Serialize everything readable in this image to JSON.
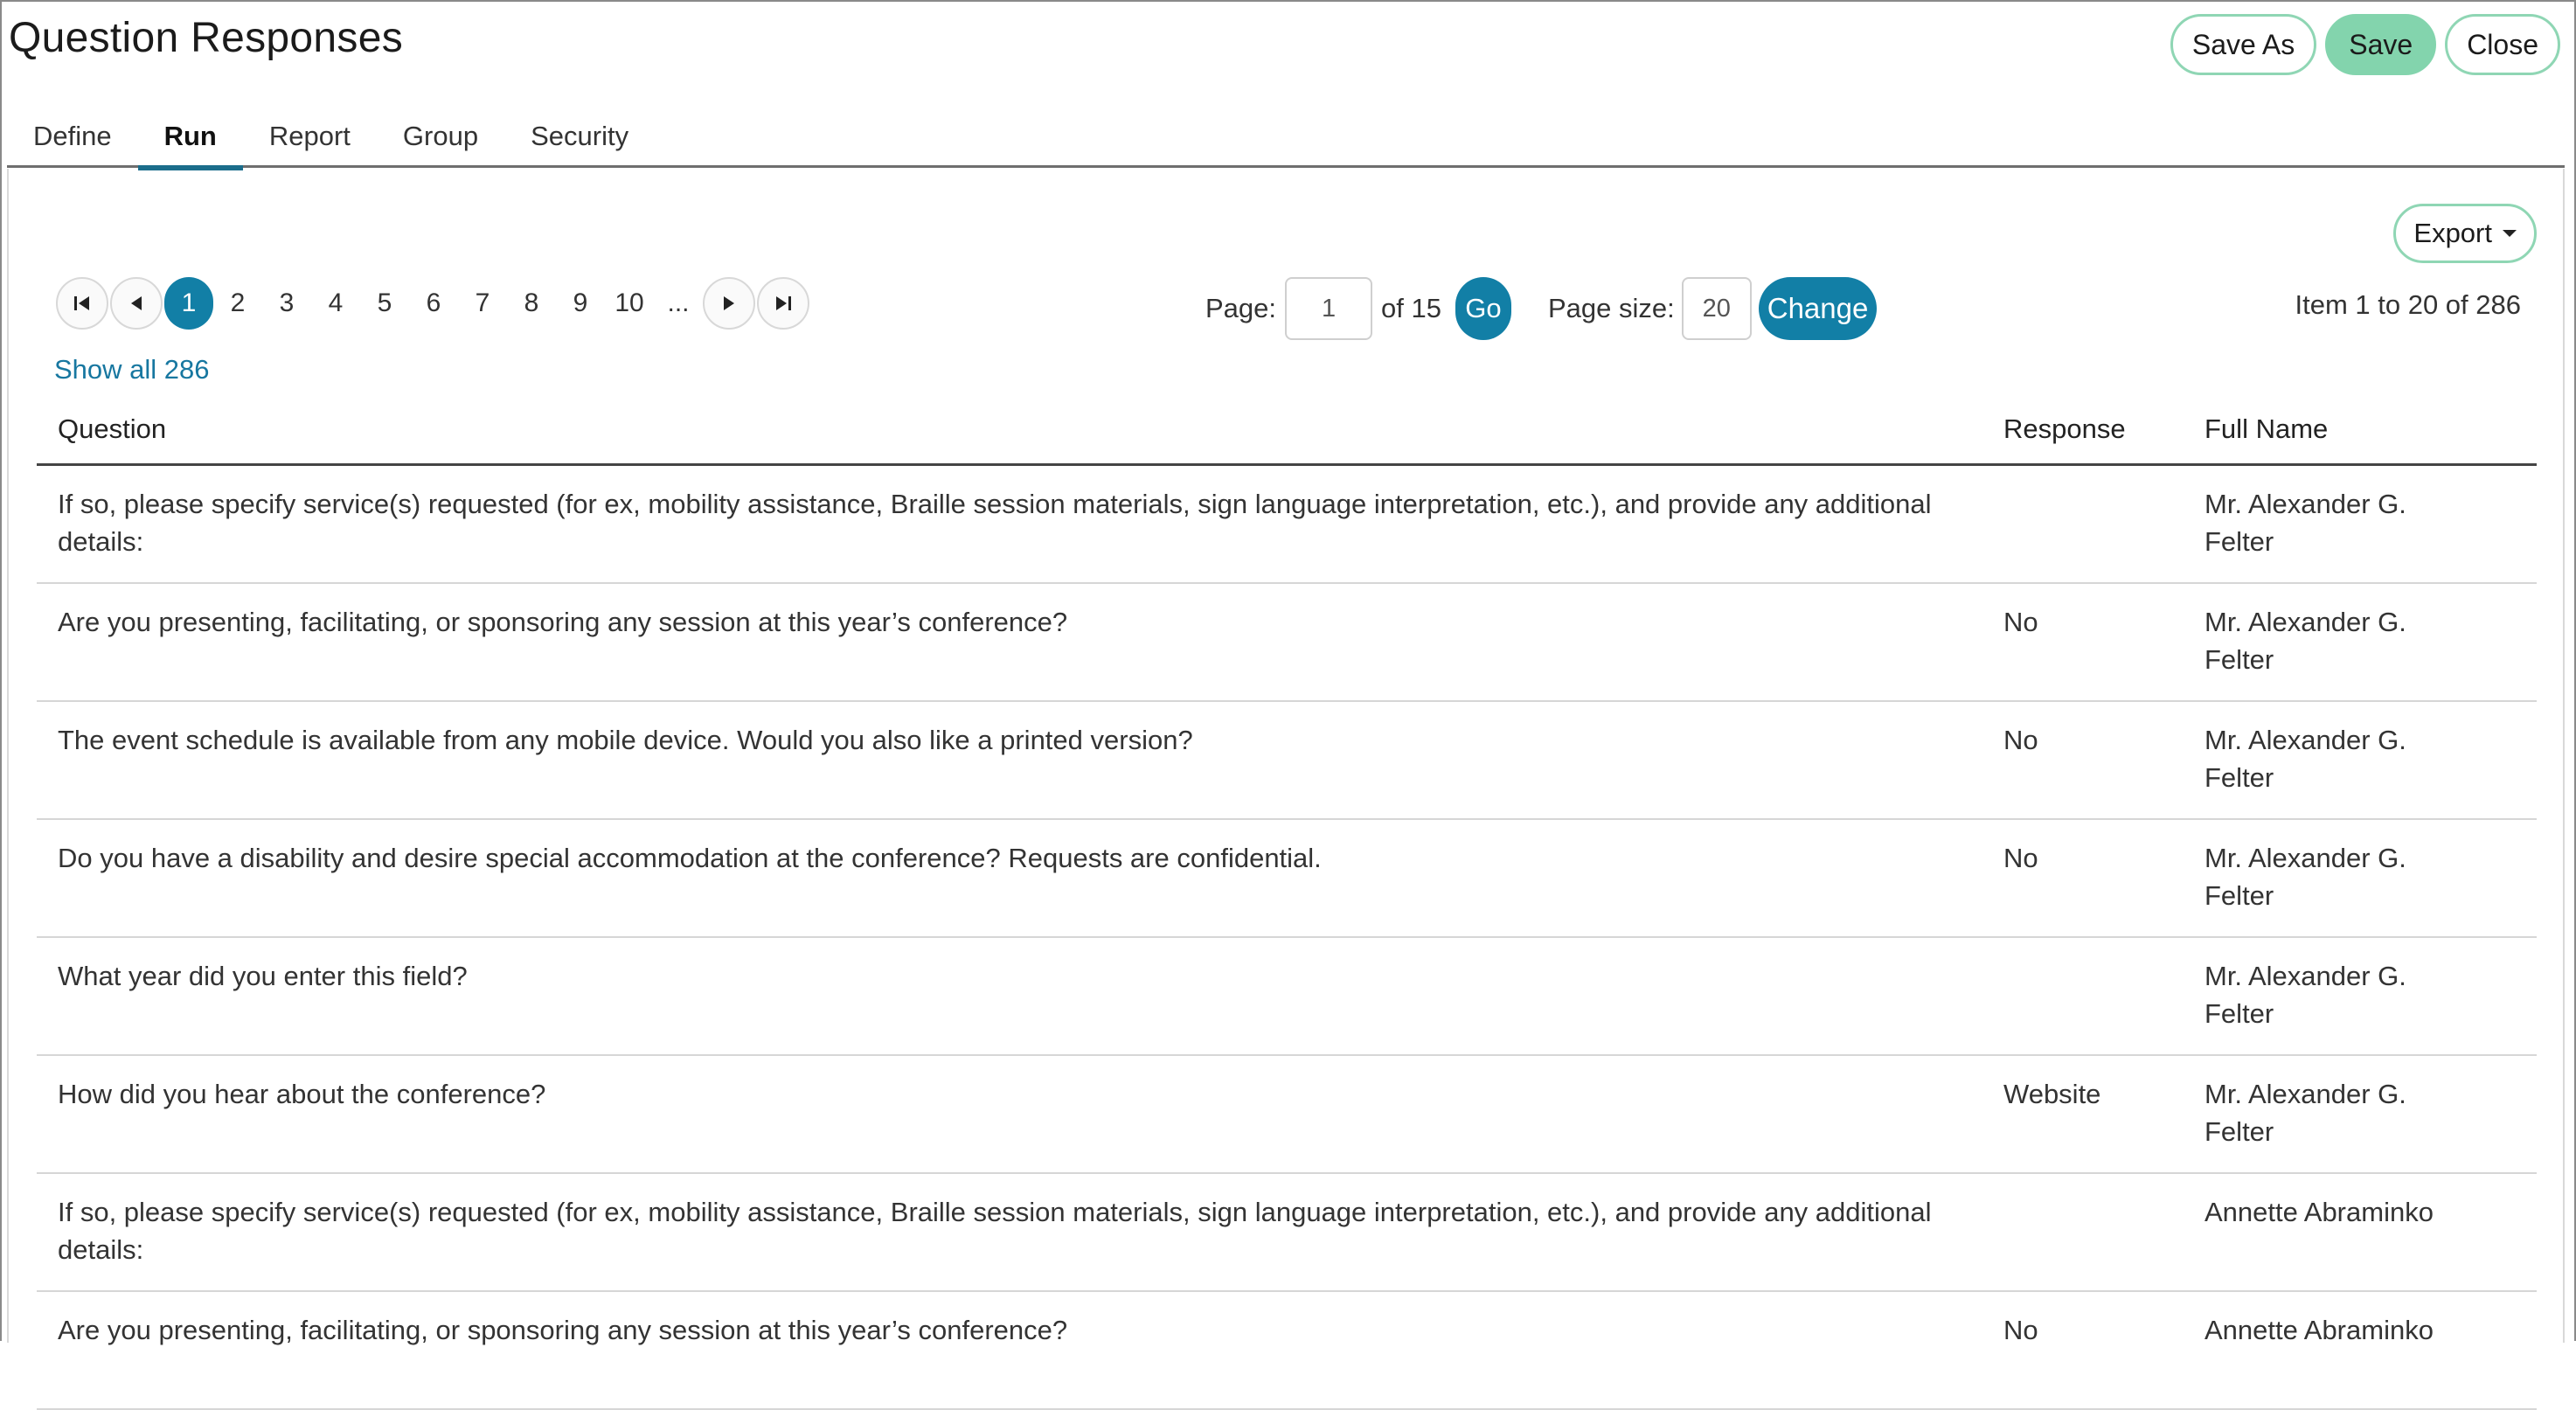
{
  "header": {
    "title": "Question Responses",
    "save_as": "Save As",
    "save": "Save",
    "close": "Close"
  },
  "tabs": [
    {
      "label": "Define",
      "active": false
    },
    {
      "label": "Run",
      "active": true
    },
    {
      "label": "Report",
      "active": false
    },
    {
      "label": "Group",
      "active": false
    },
    {
      "label": "Security",
      "active": false
    }
  ],
  "toolbar": {
    "export": "Export"
  },
  "pager": {
    "pages": [
      "1",
      "2",
      "3",
      "4",
      "5",
      "6",
      "7",
      "8",
      "9",
      "10"
    ],
    "current": "1",
    "ellipsis": "...",
    "page_label": "Page:",
    "page_value": "1",
    "of_label": "of 15",
    "go": "Go",
    "size_label": "Page size:",
    "size_value": "20",
    "change": "Change",
    "item_count": "Item 1 to 20 of 286",
    "show_all": "Show all 286"
  },
  "table": {
    "headers": {
      "question": "Question",
      "response": "Response",
      "name": "Full Name"
    },
    "rows": [
      {
        "question": "If so, please specify service(s) requested (for ex, mobility assistance, Braille session materials, sign language interpretation, etc.), and provide any additional details:",
        "response": "",
        "name": "Mr. Alexander G. Felter"
      },
      {
        "question": "Are you presenting, facilitating, or sponsoring any session at this year’s conference?",
        "response": "No",
        "name": "Mr. Alexander G. Felter"
      },
      {
        "question": "The event schedule is available from any mobile device. Would you also like a printed version?",
        "response": "No",
        "name": "Mr. Alexander G. Felter"
      },
      {
        "question": "Do you have a disability and desire special accommodation at the conference? Requests are confidential.",
        "response": "No",
        "name": "Mr. Alexander G. Felter"
      },
      {
        "question": "What year did you enter this field?",
        "response": "",
        "name": "Mr. Alexander G. Felter"
      },
      {
        "question": "How did you hear about the conference?",
        "response": "Website",
        "name": "Mr. Alexander G. Felter"
      },
      {
        "question": "If so, please specify service(s) requested (for ex, mobility assistance, Braille session materials, sign language interpretation, etc.), and provide any additional details:",
        "response": "",
        "name": "Annette Abraminko"
      },
      {
        "question": "Are you presenting, facilitating, or sponsoring any session at this year’s conference?",
        "response": "No",
        "name": "Annette Abraminko"
      }
    ]
  }
}
